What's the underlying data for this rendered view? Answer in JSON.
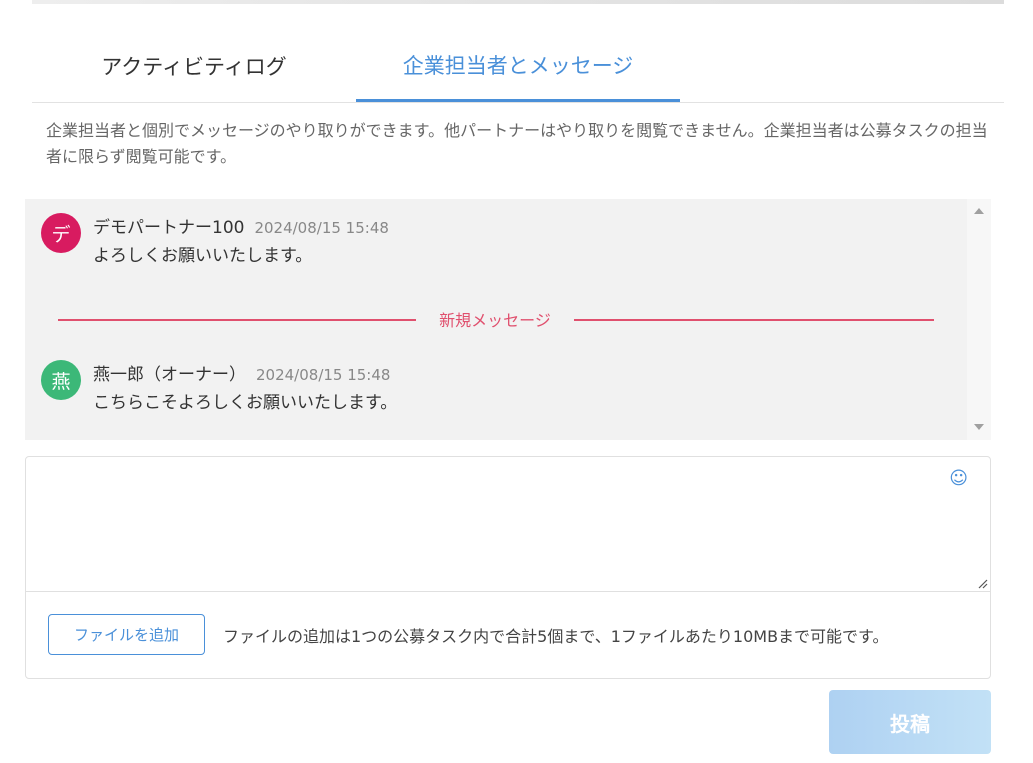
{
  "tabs": [
    {
      "label": "アクティビティログ",
      "active": false
    },
    {
      "label": "企業担当者とメッセージ",
      "active": true
    }
  ],
  "description": "企業担当者と個別でメッセージのやり取りができます。他パートナーはやり取りを閲覧できません。企業担当者は公募タスクの担当者に限らず閲覧可能です。",
  "messages": [
    {
      "avatar_char": "デ",
      "avatar_color": "#d81b60",
      "author": "デモパートナー100",
      "time": "2024/08/15 15:48",
      "body": "よろしくお願いいたします。"
    },
    {
      "avatar_char": "燕",
      "avatar_color": "#3cb878",
      "author": "燕一郎（オーナー）",
      "time": "2024/08/15 15:48",
      "body": "こちらこそよろしくお願いいたします。"
    }
  ],
  "new_message_divider": "新規メッセージ",
  "composer": {
    "emoji_icon": "smiley-icon",
    "attach_label": "ファイルを追加",
    "attach_note": "ファイルの追加は1つの公募タスク内で合計5個まで、1ファイルあたり10MBまで可能です。"
  },
  "post_label": "投稿",
  "colors": {
    "accent": "#4a90d9",
    "new_message": "#e0506e",
    "post_disabled": "#b8dbf5"
  }
}
